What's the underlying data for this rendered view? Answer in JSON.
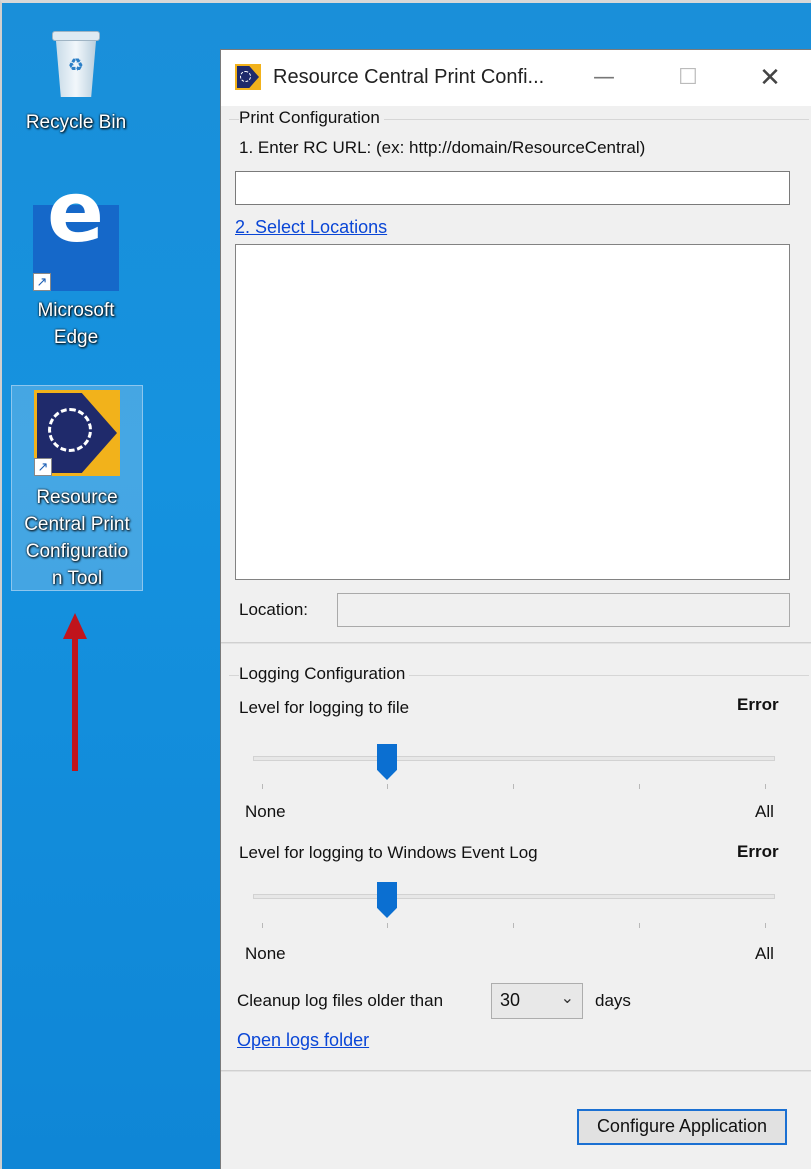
{
  "desktop": {
    "icons": [
      {
        "label": "Recycle Bin"
      },
      {
        "label_lines": [
          "Microsoft",
          "Edge"
        ]
      },
      {
        "label_lines": [
          "Resource",
          "Central Print",
          "Configuratio",
          "n Tool"
        ]
      }
    ],
    "arrow_color": "#c0141c"
  },
  "window": {
    "title": "Resource Central Print Confi...",
    "print_configuration": {
      "group_label": "Print Configuration",
      "url_instruction": "1. Enter RC URL: (ex: http://domain/ResourceCentral)",
      "url_value": "",
      "select_locations_link": "2. Select Locations",
      "location_label": "Location:",
      "location_value": ""
    },
    "logging_configuration": {
      "group_label": "Logging Configuration",
      "file_level_label": "Level for logging to file",
      "file_level_value": "Error",
      "file_level_position": 0.25,
      "event_level_label": "Level for logging to Windows Event Log",
      "event_level_value": "Error",
      "event_level_position": 0.25,
      "slider_min_label": "None",
      "slider_max_label": "All",
      "cleanup_label": "Cleanup log files older than",
      "cleanup_value": "30",
      "cleanup_unit": "days",
      "open_logs_link": "Open logs folder"
    },
    "configure_button": "Configure Application"
  }
}
